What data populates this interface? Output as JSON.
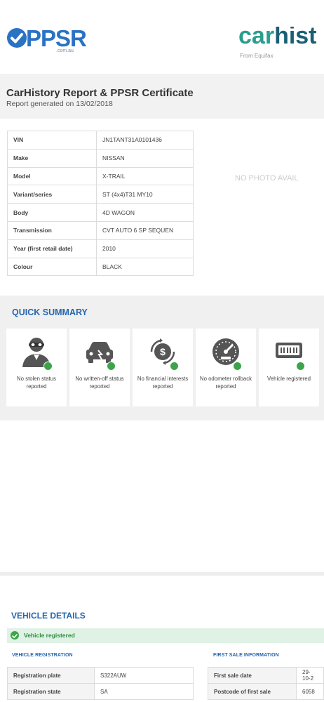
{
  "header": {
    "ppsr_logo_text": "PPSR",
    "ppsr_logo_sub": ".com.au",
    "carhist_logo_car": "car",
    "carhist_logo_hist": "hist",
    "carhist_logo_sub": "From Equifax"
  },
  "report": {
    "title": "CarHistory Report & PPSR Certificate",
    "generated": "Report generated on 13/02/2018"
  },
  "vehicle": [
    {
      "label": "VIN",
      "value": "JN1TANT31A0101436"
    },
    {
      "label": "Make",
      "value": "NISSAN"
    },
    {
      "label": "Model",
      "value": "X-TRAIL"
    },
    {
      "label": "Variant/series",
      "value": "ST (4x4)T31 MY10"
    },
    {
      "label": "Body",
      "value": "4D WAGON"
    },
    {
      "label": "Transmission",
      "value": "CVT AUTO 6 SP SEQUEN"
    },
    {
      "label": "Year (first retail date)",
      "value": "2010"
    },
    {
      "label": "Colour",
      "value": "BLACK"
    }
  ],
  "photo_placeholder": "NO PHOTO AVAIL",
  "quick_summary": {
    "title": "QUICK SUMMARY",
    "items": [
      {
        "label": "No stolen status reported",
        "icon": "thief-icon"
      },
      {
        "label": "No written-off status reported",
        "icon": "damaged-car-icon"
      },
      {
        "label": "No financial interests reported",
        "icon": "dollar-cycle-icon"
      },
      {
        "label": "No odometer rollback reported",
        "icon": "odometer-icon"
      },
      {
        "label": "Vehicle registered",
        "icon": "plate-icon"
      }
    ]
  },
  "vehicle_details": {
    "title": "VEHICLE DETAILS",
    "status": "Vehicle registered",
    "registration_heading": "VEHICLE REGISTRATION",
    "registration": [
      {
        "label": "Registration plate",
        "value": "S322AUW"
      },
      {
        "label": "Registration state",
        "value": "SA"
      }
    ],
    "first_sale_heading": "FIRST SALE INFORMATION",
    "first_sale": [
      {
        "label": "First sale date",
        "value": "29-10-2"
      },
      {
        "label": "Postcode of first sale",
        "value": "6058"
      }
    ]
  },
  "colors": {
    "accent_blue": "#2566ad",
    "check_green": "#3ca549",
    "status_bg": "#dff2e5"
  }
}
